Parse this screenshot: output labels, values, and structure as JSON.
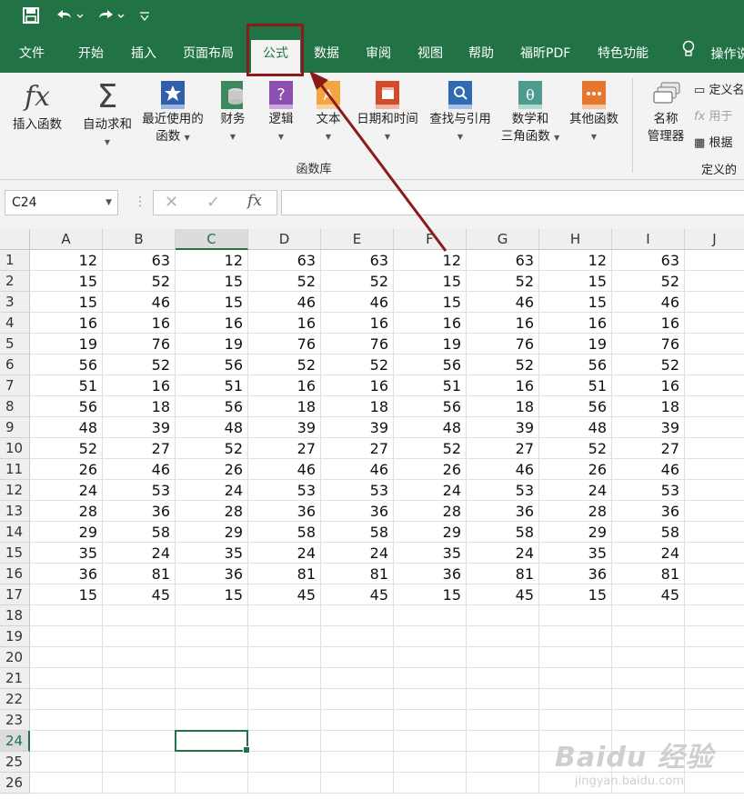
{
  "qat": {
    "save_icon": "save-icon",
    "undo_icon": "undo-icon",
    "redo_icon": "redo-icon",
    "customize_icon": "customize-qat-icon"
  },
  "tabs": [
    {
      "label": "文件"
    },
    {
      "label": "开始"
    },
    {
      "label": "插入"
    },
    {
      "label": "页面布局"
    },
    {
      "label": "公式"
    },
    {
      "label": "数据"
    },
    {
      "label": "审阅"
    },
    {
      "label": "视图"
    },
    {
      "label": "帮助"
    },
    {
      "label": "福昕PDF"
    },
    {
      "label": "特色功能"
    }
  ],
  "tell_me": {
    "label": "操作说"
  },
  "ribbon": {
    "insert_function": "插入函数",
    "autosum": "自动求和",
    "recent": {
      "line1": "最近使用的",
      "line2": "函数"
    },
    "financial": "财务",
    "logical": "逻辑",
    "text": "文本",
    "datetime": "日期和时间",
    "lookup": "查找与引用",
    "math": {
      "line1": "数学和",
      "line2": "三角函数"
    },
    "more": "其他函数",
    "group_label": "函数库",
    "name_manager": {
      "line1": "名称",
      "line2": "管理器"
    },
    "define_name": "定义名",
    "use_in_formula": "用于",
    "create_from_selection": "根据",
    "defined_names_group": "定义的"
  },
  "formula_bar": {
    "name_box": "C24",
    "cancel_icon": "cancel-icon",
    "enter_icon": "enter-icon",
    "fx_label": "fx"
  },
  "columns": [
    "A",
    "B",
    "C",
    "D",
    "E",
    "F",
    "G",
    "H",
    "I",
    "J"
  ],
  "rows": [
    [
      12,
      63,
      12,
      63,
      63,
      12,
      63,
      12,
      63
    ],
    [
      15,
      52,
      15,
      52,
      52,
      15,
      52,
      15,
      52
    ],
    [
      15,
      46,
      15,
      46,
      46,
      15,
      46,
      15,
      46
    ],
    [
      16,
      16,
      16,
      16,
      16,
      16,
      16,
      16,
      16
    ],
    [
      19,
      76,
      19,
      76,
      76,
      19,
      76,
      19,
      76
    ],
    [
      56,
      52,
      56,
      52,
      52,
      56,
      52,
      56,
      52
    ],
    [
      51,
      16,
      51,
      16,
      16,
      51,
      16,
      51,
      16
    ],
    [
      56,
      18,
      56,
      18,
      18,
      56,
      18,
      56,
      18
    ],
    [
      48,
      39,
      48,
      39,
      39,
      48,
      39,
      48,
      39
    ],
    [
      52,
      27,
      52,
      27,
      27,
      52,
      27,
      52,
      27
    ],
    [
      26,
      46,
      26,
      46,
      46,
      26,
      46,
      26,
      46
    ],
    [
      24,
      53,
      24,
      53,
      53,
      24,
      53,
      24,
      53
    ],
    [
      28,
      36,
      28,
      36,
      36,
      28,
      36,
      28,
      36
    ],
    [
      29,
      58,
      29,
      58,
      58,
      29,
      58,
      29,
      58
    ],
    [
      35,
      24,
      35,
      24,
      24,
      35,
      24,
      35,
      24
    ],
    [
      36,
      81,
      36,
      81,
      81,
      36,
      81,
      36,
      81
    ],
    [
      15,
      45,
      15,
      45,
      45,
      15,
      45,
      15,
      45
    ]
  ],
  "row_numbers": [
    "1",
    "2",
    "3",
    "4",
    "5",
    "6",
    "7",
    "8",
    "9",
    "10",
    "11",
    "12",
    "13",
    "14",
    "15",
    "16",
    "17",
    "18",
    "19",
    "20",
    "21",
    "22",
    "23",
    "24",
    "25",
    "26"
  ],
  "selected": {
    "col": "C",
    "row": "24"
  },
  "watermark": {
    "line1": "Baidu 经验",
    "line2": "jingyan.baidu.com"
  },
  "colors": {
    "accent": "#217346",
    "callout": "#8b1a1a"
  }
}
